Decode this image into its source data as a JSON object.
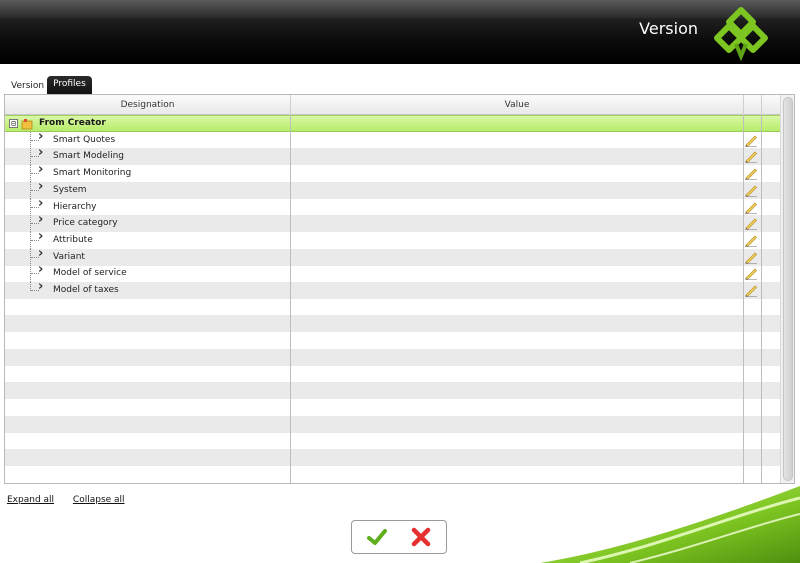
{
  "header": {
    "title": "Version",
    "logo_icon": "green-diamond-logo-icon"
  },
  "tabs": [
    {
      "label": "Version",
      "active": false
    },
    {
      "label": "Profiles",
      "active": true
    }
  ],
  "grid": {
    "columns": [
      "Designation",
      "Value"
    ],
    "root": {
      "label": "From Creator",
      "expanded": true,
      "toggle": "⊟"
    },
    "items": [
      {
        "label": "Smart Quotes"
      },
      {
        "label": "Smart Modeling"
      },
      {
        "label": "Smart Monitoring"
      },
      {
        "label": "System"
      },
      {
        "label": "Hierarchy"
      },
      {
        "label": "Price category"
      },
      {
        "label": "Attribute"
      },
      {
        "label": "Variant"
      },
      {
        "label": "Model of service"
      },
      {
        "label": "Model of taxes"
      }
    ]
  },
  "links": {
    "expand_all": "Expand all",
    "collapse_all": "Collapse all"
  },
  "actions": {
    "ok_icon": "checkmark-icon",
    "cancel_icon": "cross-icon"
  },
  "colors": {
    "accent_green": "#7dc521",
    "row_highlight": "#c8f08a",
    "cancel_red": "#e53030"
  }
}
